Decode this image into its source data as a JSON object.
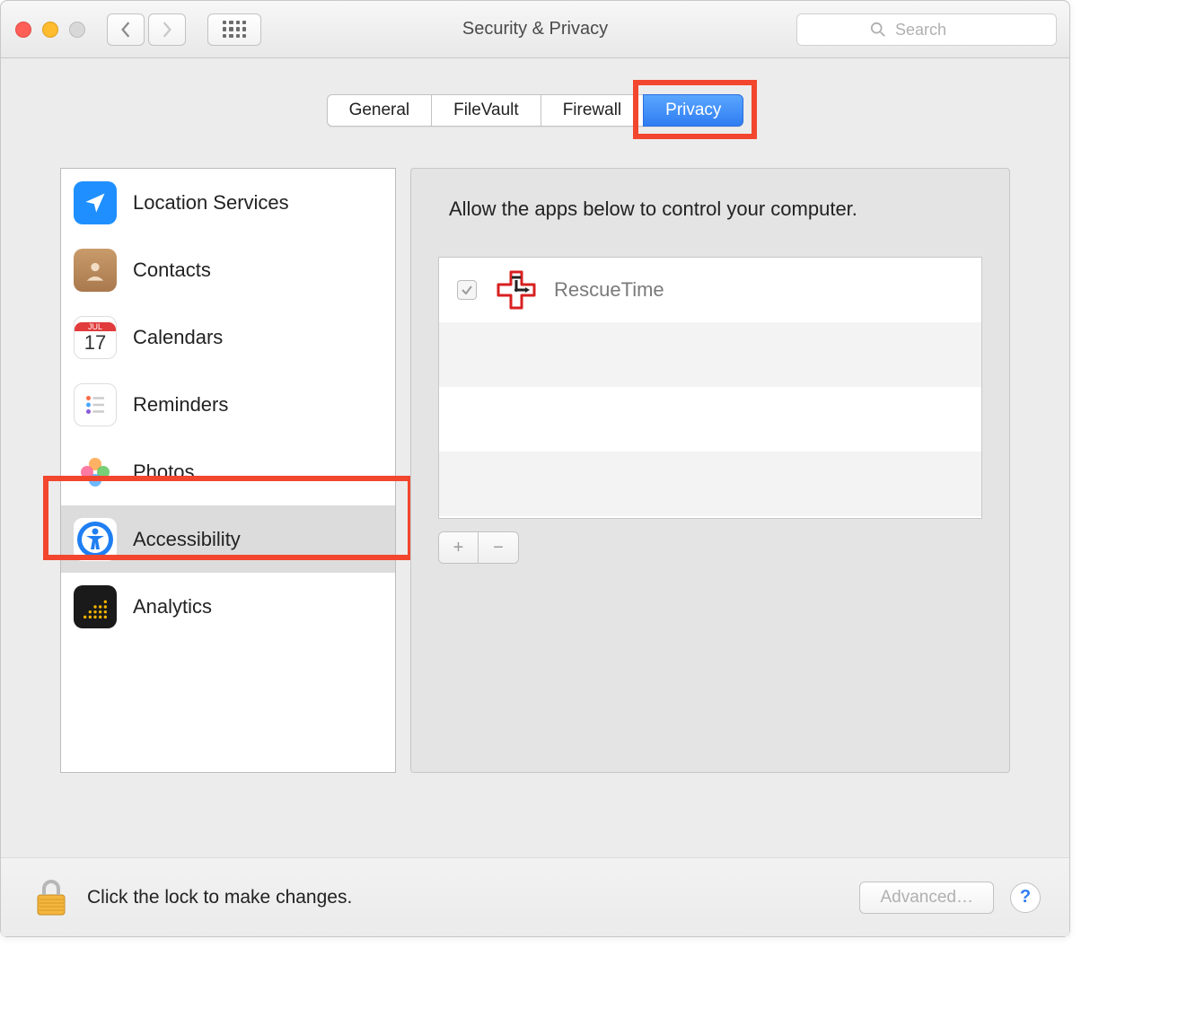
{
  "window_title": "Security & Privacy",
  "search_placeholder": "Search",
  "tabs": [
    {
      "label": "General",
      "active": false
    },
    {
      "label": "FileVault",
      "active": false
    },
    {
      "label": "Firewall",
      "active": false
    },
    {
      "label": "Privacy",
      "active": true
    }
  ],
  "sidebar": {
    "items": [
      {
        "label": "Location Services",
        "icon": "location",
        "selected": false
      },
      {
        "label": "Contacts",
        "icon": "contacts",
        "selected": false
      },
      {
        "label": "Calendars",
        "icon": "calendar",
        "selected": false
      },
      {
        "label": "Reminders",
        "icon": "reminders",
        "selected": false
      },
      {
        "label": "Photos",
        "icon": "photos",
        "selected": false
      },
      {
        "label": "Accessibility",
        "icon": "accessibility",
        "selected": true
      },
      {
        "label": "Analytics",
        "icon": "analytics",
        "selected": false
      }
    ]
  },
  "calendar_icon": {
    "month": "JUL",
    "day": "17"
  },
  "right_pane": {
    "heading": "Allow the apps below to control your computer.",
    "apps": [
      {
        "name": "RescueTime",
        "checked": true
      }
    ]
  },
  "footer": {
    "lock_text": "Click the lock to make changes.",
    "advanced_label": "Advanced…"
  },
  "highlight_color": "#f2462e"
}
